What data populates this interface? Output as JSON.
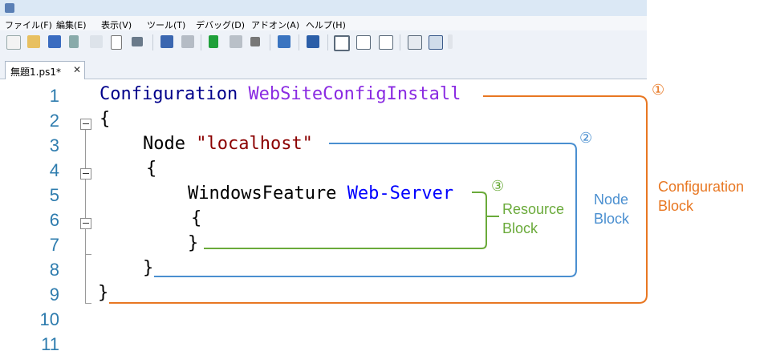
{
  "menu": [
    "ファイル(F)",
    "編集(E)",
    "表示(V)",
    "ツール(T)",
    "デバッグ(D)",
    "アドオン(A)",
    "ヘルプ(H)"
  ],
  "tab": {
    "label": "無題1.ps1*",
    "close": "✕"
  },
  "line_numbers": [
    "1",
    "2",
    "3",
    "4",
    "5",
    "6",
    "7",
    "8",
    "9",
    "10",
    "11"
  ],
  "code": {
    "l1_kw": "Configuration",
    "l1_name": "WebSiteConfigInstall",
    "l2": "{",
    "l3_kw": "Node",
    "l3_str": "\"localhost\"",
    "l4": "{",
    "l5_kw": "WindowsFeature",
    "l5_name": "Web-Server",
    "l6": "{",
    "l7": "}",
    "l8": "}",
    "l9": "}"
  },
  "annotations": {
    "c1": "①",
    "c2": "②",
    "c3": "③",
    "resource": [
      "Resource",
      "Block"
    ],
    "node": [
      "Node",
      "Block"
    ],
    "configuration": [
      "Configuration",
      "Block"
    ]
  },
  "colors": {
    "configuration": "#e87722",
    "node": "#4a8fd0",
    "resource": "#6aaa3a",
    "line_number": "#2e7cae"
  }
}
